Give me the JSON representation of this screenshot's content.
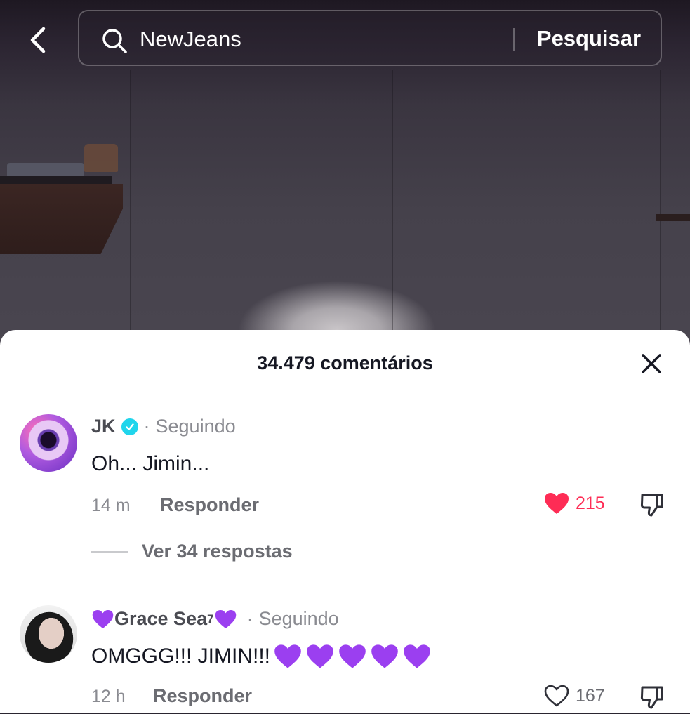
{
  "search": {
    "query": "NewJeans",
    "submit_label": "Pesquisar"
  },
  "comments_sheet": {
    "title": "34.479 comentários",
    "comments": [
      {
        "username": "JK",
        "verified": true,
        "separator": "·",
        "follow_status": "Seguindo",
        "text": "Oh... Jimin...",
        "time": "14 m",
        "reply_label": "Responder",
        "like_count": "215",
        "liked": true,
        "replies_label": "Ver 34 respostas"
      },
      {
        "username": "Grace Sea",
        "username_superscript": "7",
        "username_decoration": "purple-heart",
        "separator": "·",
        "follow_status": "Seguindo",
        "text": "OMGGG!!! JIMIN!!!",
        "text_emoji": "purple-heart",
        "text_emoji_count": 5,
        "time": "12 h",
        "reply_label": "Responder",
        "like_count": "167",
        "liked": false
      }
    ]
  },
  "colors": {
    "like_active": "#fe2c55",
    "verified_badge": "#20d5ec",
    "purple_heart": "#9b3ff0"
  },
  "icons": [
    "back-chevron-icon",
    "search-icon",
    "close-icon",
    "verified-icon",
    "heart-icon",
    "dislike-icon",
    "purple-heart-icon"
  ]
}
